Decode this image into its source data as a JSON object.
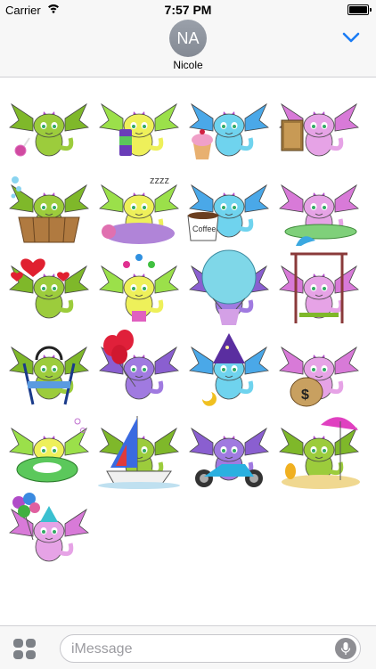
{
  "status_bar": {
    "carrier": "Carrier",
    "time": "7:57 PM",
    "battery_level": 1.0
  },
  "header": {
    "avatar_initials": "NA",
    "contact_name": "Nicole"
  },
  "input_bar": {
    "placeholder": "iMessage"
  },
  "colors": {
    "green_dragon": "#9ccc3c",
    "yellow_dragon": "#eef05a",
    "cyan_dragon": "#6fd3ee",
    "pink_dragon": "#e6a3e6",
    "purple_dragon": "#a07ae0",
    "ios_blue": "#1a7cf5"
  },
  "stickers": [
    {
      "icon": "green-dragon-lollipop-sticker",
      "body": "green",
      "prop": "lollipop"
    },
    {
      "icon": "yellow-dragon-candy-can-sticker",
      "body": "yellow",
      "prop": "can"
    },
    {
      "icon": "cyan-dragon-cupcake-sticker",
      "body": "cyan",
      "prop": "cupcake"
    },
    {
      "icon": "pink-dragon-book-sticker",
      "body": "pink",
      "prop": "book"
    },
    {
      "icon": "green-dragon-bathtub-sticker",
      "body": "green",
      "prop": "tub"
    },
    {
      "icon": "yellow-dragon-sleeping-sticker",
      "body": "yellow",
      "prop": "sleep"
    },
    {
      "icon": "cyan-dragon-coffee-sticker",
      "body": "cyan",
      "prop": "coffee",
      "prop_text": "Coffee"
    },
    {
      "icon": "pink-dragon-surfing-sticker",
      "body": "pink",
      "prop": "surf"
    },
    {
      "icon": "green-dragon-hearts-sticker",
      "body": "green",
      "prop": "hearts"
    },
    {
      "icon": "yellow-dragon-jester-sticker",
      "body": "yellow",
      "prop": "jester"
    },
    {
      "icon": "purple-dragon-hot-air-balloon-sticker",
      "body": "purple",
      "prop": "balloon"
    },
    {
      "icon": "pink-dragon-swing-sticker",
      "body": "pink",
      "prop": "swing"
    },
    {
      "icon": "green-dragon-chair-headphones-sticker",
      "body": "green",
      "prop": "chair"
    },
    {
      "icon": "purple-dragon-red-balloons-sticker",
      "body": "purple",
      "prop": "balloons"
    },
    {
      "icon": "cyan-dragon-wizard-sticker",
      "body": "cyan",
      "prop": "wizard"
    },
    {
      "icon": "pink-dragon-money-bag-sticker",
      "body": "pink",
      "prop": "money",
      "prop_text": "$"
    },
    {
      "icon": "yellow-dragon-swim-ring-sticker",
      "body": "yellow",
      "prop": "ring"
    },
    {
      "icon": "green-dragon-sailboat-sticker",
      "body": "green",
      "prop": "boat"
    },
    {
      "icon": "purple-dragon-motorcycle-sticker",
      "body": "purple",
      "prop": "moto"
    },
    {
      "icon": "green-dragon-beach-umbrella-sticker",
      "body": "green",
      "prop": "beach"
    },
    {
      "icon": "pink-dragon-party-balloons-sticker",
      "body": "pink",
      "prop": "party"
    }
  ]
}
